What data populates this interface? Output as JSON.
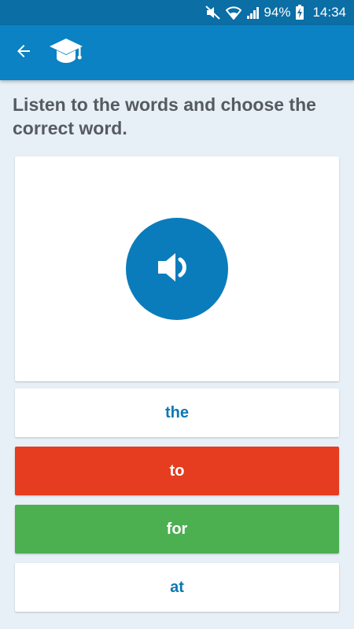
{
  "status_bar": {
    "battery": "94%",
    "time": "14:34",
    "icons": [
      "mute-icon",
      "wifi-icon",
      "signal-icon",
      "battery-charging-icon"
    ]
  },
  "app_bar": {
    "back_icon": "back-arrow-icon",
    "logo_icon": "graduation-cap-icon"
  },
  "quiz": {
    "instruction": "Listen to the words and choose the correct word.",
    "play_icon": "speaker-icon",
    "answers": [
      {
        "label": "the",
        "state": "neutral"
      },
      {
        "label": "to",
        "state": "wrong"
      },
      {
        "label": "for",
        "state": "correct"
      },
      {
        "label": "at",
        "state": "neutral"
      }
    ]
  },
  "colors": {
    "status_bar": "#0b6ea5",
    "app_bar": "#0a82c3",
    "background": "#e8f0f7",
    "play_button": "#0b7cbb",
    "wrong": "#e63c1f",
    "correct": "#4caf50",
    "answer_text": "#0a78b5"
  }
}
